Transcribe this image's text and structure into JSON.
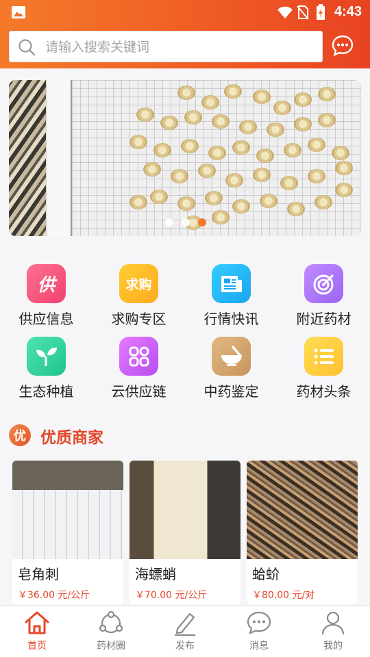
{
  "status_bar": {
    "time": "4:43",
    "icons": [
      "gallery-icon",
      "signal-icon",
      "no-sim-icon",
      "battery-icon"
    ]
  },
  "search": {
    "placeholder": "请输入搜索关键词",
    "value": ""
  },
  "header": {
    "message_icon": "chat-bubble-icon"
  },
  "banner": {
    "slides_count": 3,
    "active_slide": 3
  },
  "menu": {
    "items": [
      {
        "label": "供应信息",
        "icon": "supply-icon",
        "glyph": "供",
        "color_from": "#ff6f91",
        "color_to": "#f0436f"
      },
      {
        "label": "求购专区",
        "icon": "purchase-icon",
        "glyph": "求购",
        "color_from": "#ffcc33",
        "color_to": "#ffab1f"
      },
      {
        "label": "行情快讯",
        "icon": "news-icon",
        "glyph": "",
        "color_from": "#33ccff",
        "color_to": "#1aa6f0"
      },
      {
        "label": "附近药材",
        "icon": "target-icon",
        "glyph": "",
        "color_from": "#c08bff",
        "color_to": "#9a66f5"
      },
      {
        "label": "生态种植",
        "icon": "sprout-icon",
        "glyph": "",
        "color_from": "#4fe3b3",
        "color_to": "#20c48c"
      },
      {
        "label": "云供应链",
        "icon": "apps-icon",
        "glyph": "",
        "color_from": "#e37bff",
        "color_to": "#b94df0"
      },
      {
        "label": "中药鉴定",
        "icon": "mortar-icon",
        "glyph": "",
        "color_from": "#e0b883",
        "color_to": "#c8955c"
      },
      {
        "label": "药材头条",
        "icon": "list-icon",
        "glyph": "",
        "color_from": "#ffdd55",
        "color_to": "#ffc130"
      }
    ]
  },
  "section": {
    "badge": "优",
    "title": "优质商家"
  },
  "products": [
    {
      "name": "皂角刺",
      "price": "￥36.00 元/公斤"
    },
    {
      "name": "海螵蛸",
      "price": "￥70.00 元/公斤"
    },
    {
      "name": "蛤蚧",
      "price": "￥80.00 元/对"
    }
  ],
  "bottom_nav": [
    {
      "label": "首页",
      "icon": "home-icon",
      "active": true
    },
    {
      "label": "药材圈",
      "icon": "circle-share-icon",
      "active": false
    },
    {
      "label": "发布",
      "icon": "edit-pencil-icon",
      "active": false
    },
    {
      "label": "消息",
      "icon": "chat-bubble-icon",
      "active": false
    },
    {
      "label": "我的",
      "icon": "user-icon",
      "active": false
    }
  ],
  "colors": {
    "brand": "#ef5a24",
    "price": "#e8452a",
    "title": "#e1472a"
  }
}
